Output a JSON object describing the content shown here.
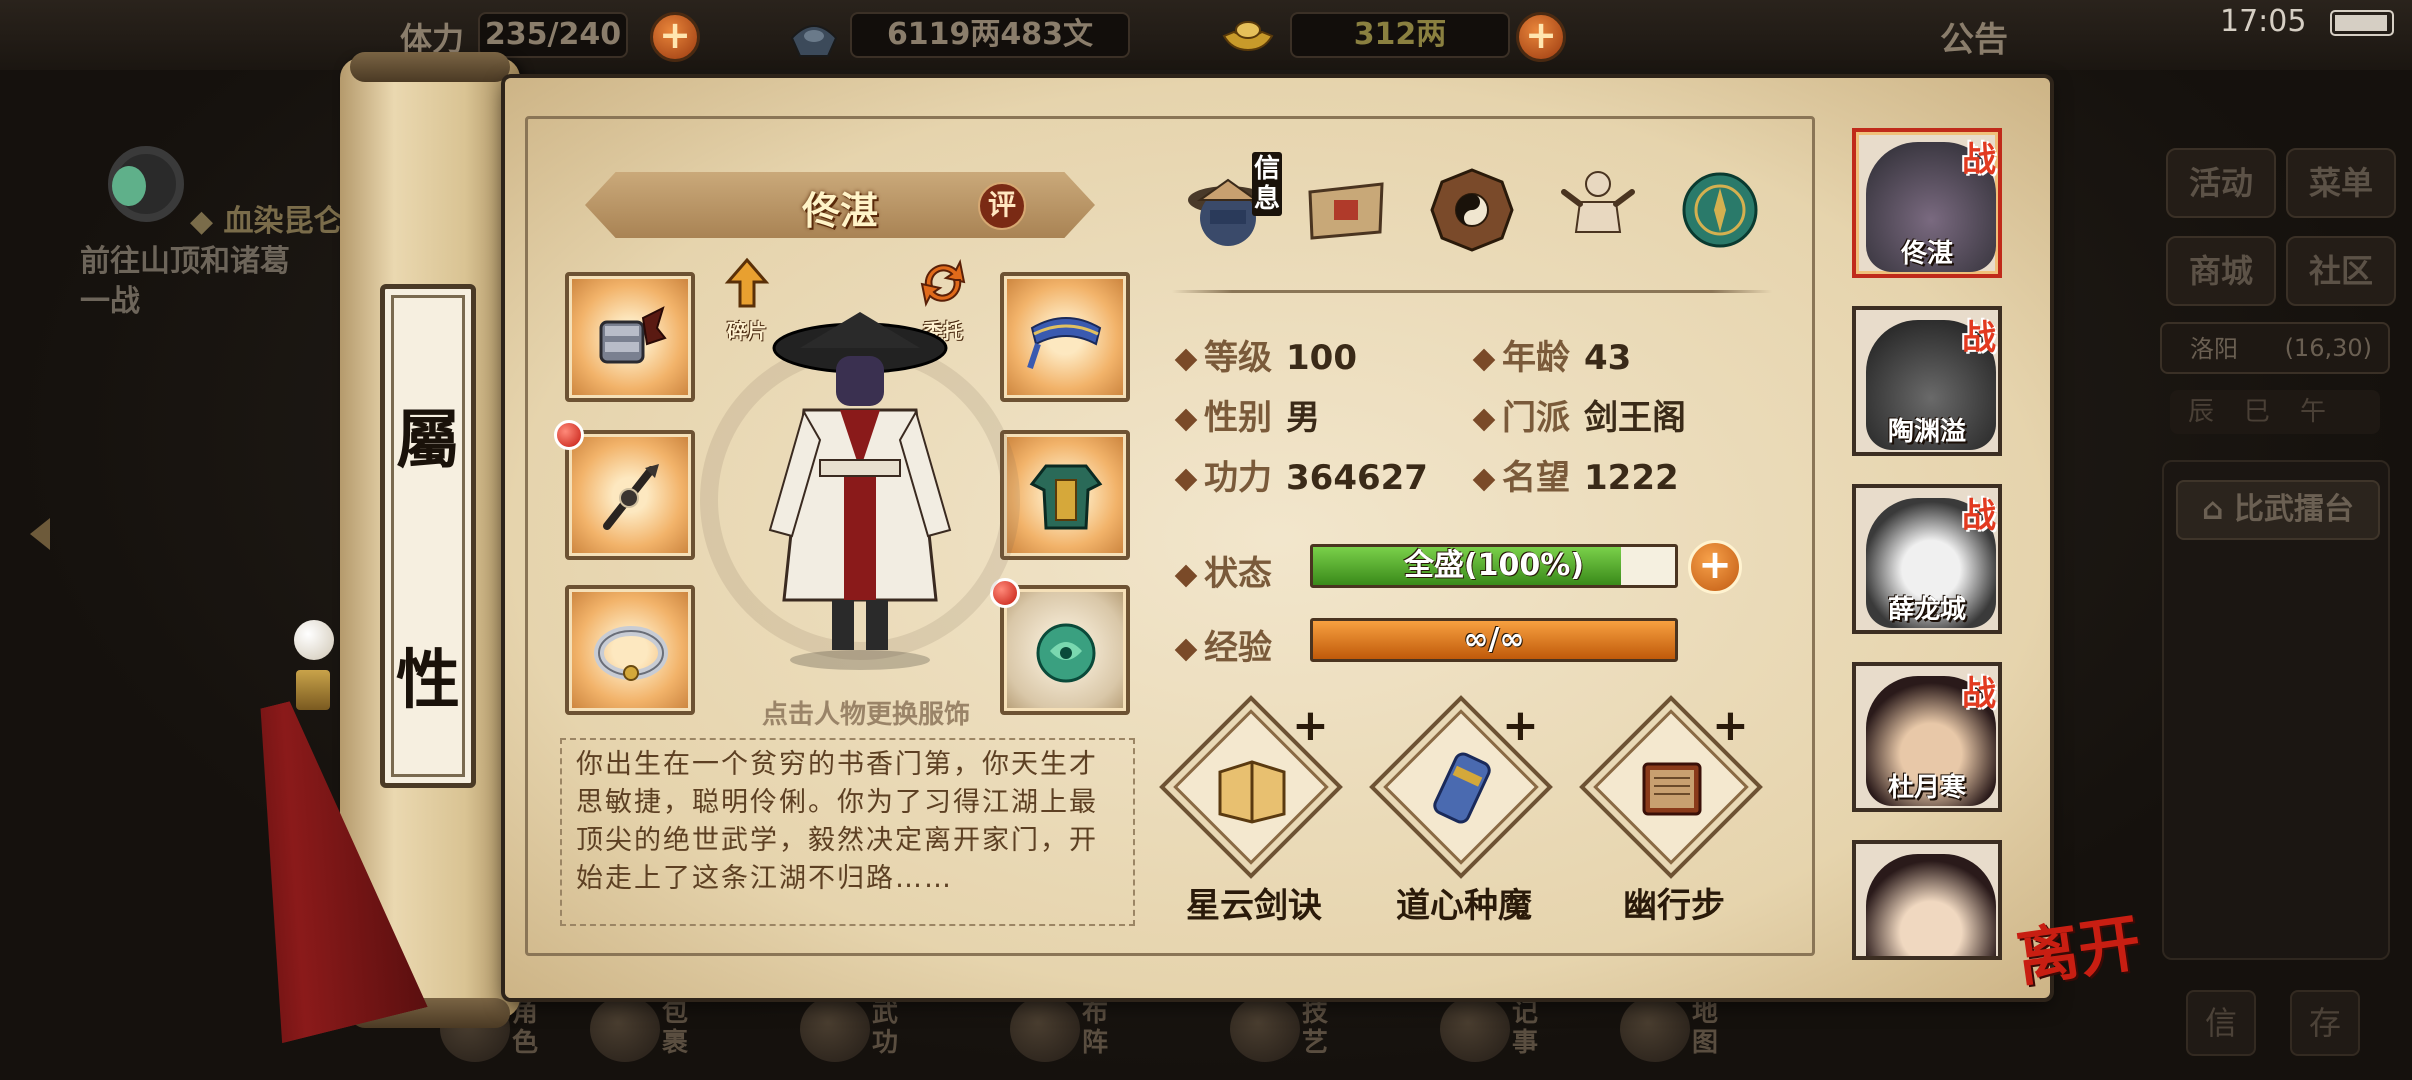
{
  "status_bar": {
    "time": "17:05"
  },
  "resources": {
    "stamina_label": "体力",
    "stamina": "235/240",
    "money": "6119两483文",
    "gold": "312两",
    "announcement": "公告"
  },
  "quest": {
    "title": "血染昆仑",
    "desc_line1": "前往山顶和诸葛",
    "desc_line2": "一战"
  },
  "right_menu": {
    "activity": "活动",
    "menu": "菜单",
    "shop": "商城",
    "community": "社区",
    "location": "洛阳",
    "coords": "(16,30)",
    "time_signs": "辰巳午",
    "arena": "比武擂台",
    "bottom_left": "信",
    "bottom_right": "存"
  },
  "bottom_nav": [
    {
      "label": "角色"
    },
    {
      "label": "包裹"
    },
    {
      "label": "武功"
    },
    {
      "label": "布阵"
    },
    {
      "label": "技艺"
    },
    {
      "label": "记事"
    },
    {
      "label": "地图"
    }
  ],
  "tab": {
    "char1": "屬",
    "char2": "性"
  },
  "character": {
    "name": "佟湛",
    "rate_label": "评",
    "fragments_label": "碎片",
    "entrust_label": "委托",
    "tap_hint": "点击人物更换服饰",
    "bio": "你出生在一个贫穷的书香门第，你天生才思敏捷，聪明伶俐。你为了习得江湖上最顶尖的绝世武学，毅然决定离开家门，开始走上了这条江湖不归路……"
  },
  "top_tabs": {
    "info_label": "信息"
  },
  "stats": {
    "level_label": "等级",
    "level": "100",
    "age_label": "年龄",
    "age": "43",
    "gender_label": "性别",
    "gender": "男",
    "sect_label": "门派",
    "sect": "剑王阁",
    "power_label": "功力",
    "power": "364627",
    "fame_label": "名望",
    "fame": "1222",
    "status_label": "状态",
    "status_text": "全盛(100%)",
    "status_fill": 0.85,
    "exp_label": "经验",
    "exp_text": "∞/∞",
    "exp_fill": 1.0
  },
  "skills": [
    {
      "name": "星云剑诀"
    },
    {
      "name": "道心种魔"
    },
    {
      "name": "幽行步"
    }
  ],
  "team": {
    "battle_badge": "战",
    "members": [
      "佟湛",
      "陶渊溢",
      "薛龙城",
      "杜月寒",
      ""
    ]
  },
  "leave_label": "离开",
  "colors": {
    "status_green": "#4faa2a",
    "exp_orange": "#e07a12",
    "active_red": "#c02a1a"
  }
}
